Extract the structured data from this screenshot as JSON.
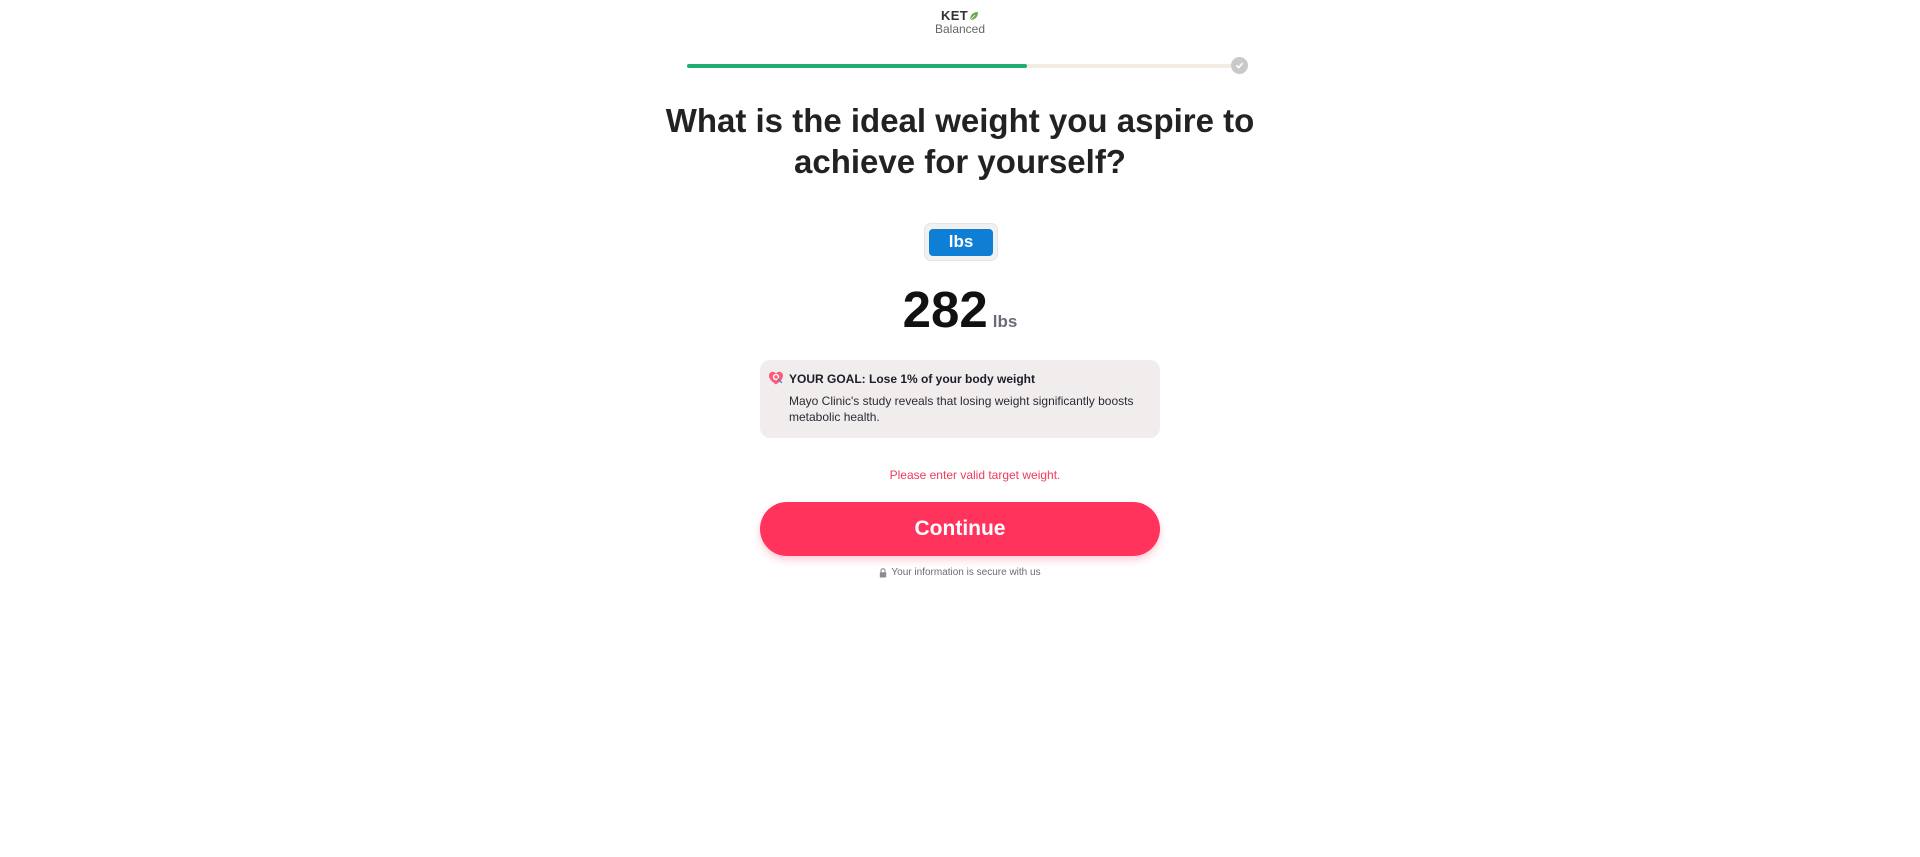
{
  "header": {
    "logo_top": "KET",
    "logo_bottom": "Balanced",
    "brand_green": "#6aa84f"
  },
  "progress": {
    "fraction": 0.62,
    "fill_color": "#1fae6f",
    "end_icon": "check-icon"
  },
  "question": {
    "title": "What is the ideal weight you aspire to achieve for yourself?"
  },
  "units": {
    "selected": "lbs",
    "accent": "#0f7fd6"
  },
  "weight": {
    "value": "282",
    "unit": "lbs"
  },
  "goal": {
    "icon": "heart-target-icon",
    "title": "YOUR GOAL: Lose 1% of your body weight",
    "text": "Mayo Clinic's study reveals that losing weight significantly boosts metabolic health."
  },
  "error": {
    "message": "Please enter valid target weight.",
    "color": "#ee3a5b"
  },
  "actions": {
    "continue_label": "Continue",
    "button_color": "#ff335c"
  },
  "footer": {
    "secure_icon": "lock-icon",
    "secure_text": "Your information is secure with us"
  }
}
